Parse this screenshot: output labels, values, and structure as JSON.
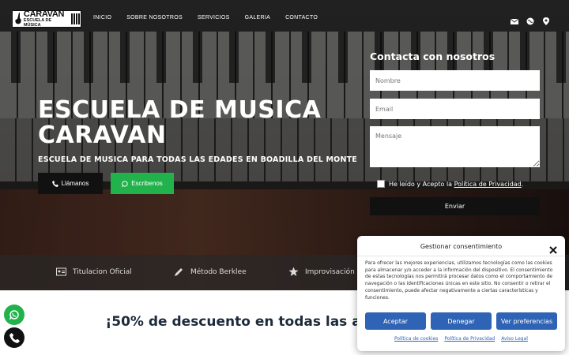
{
  "brand": {
    "logo_line1": "CARAVAN",
    "logo_line2": "ESCUELA DE MÚSICA"
  },
  "nav": {
    "items": [
      {
        "label": "INICIO"
      },
      {
        "label": "SOBRE NOSOTROS"
      },
      {
        "label": "SERVICIOS"
      },
      {
        "label": "GALERIA"
      },
      {
        "label": "CONTACTO"
      }
    ],
    "icons": [
      "envelope-icon",
      "globe-icon",
      "map-pin-icon"
    ]
  },
  "hero": {
    "title": "ESCUELA DE MUSICA CARAVAN",
    "subtitle": "ESCUELA DE MUSICA PARA TODAS LAS EDADES EN BOADILLA DEL MONTE",
    "call_label": "Llámanos",
    "write_label": "Escribenos"
  },
  "contact_form": {
    "title": "Contacta con nosotros",
    "name_placeholder": "Nombre",
    "email_placeholder": "Email",
    "message_placeholder": "Mensaje",
    "consent_prefix": "He leído y Acepto la ",
    "consent_link": "Política de Privacidad",
    "consent_suffix": ".",
    "submit_label": "Enviar"
  },
  "features": [
    {
      "label": "Titulacion Oficial",
      "icon": "id-card-icon"
    },
    {
      "label": "Método Berklee",
      "icon": "pencil-icon"
    },
    {
      "label": "Improvisación",
      "icon": "star-icon"
    }
  ],
  "promo": {
    "text": "¡50% de descuento en todas las actividad                   mes!"
  },
  "consent_modal": {
    "title": "Gestionar consentimiento",
    "body": "Para ofrecer las mejores experiencias, utilizamos tecnologías como las cookies para almacenar y/o acceder a la información del dispositivo. El consentimiento de estas tecnologías nos permitirá procesar datos como el comportamiento de navegación o las identificaciones únicas en este sitio. No consentir o retirar el consentimiento, puede afectar negativamente a ciertas características y funciones.",
    "accept_label": "Aceptar",
    "deny_label": "Denegar",
    "prefs_label": "Ver preferencias",
    "links": [
      "Política de cookies",
      "Política de Privacidad",
      "Aviso Legal"
    ]
  },
  "colors": {
    "green": "#21b24b",
    "modal_blue": "#2f63b5",
    "promo_text": "#1d2a3a"
  }
}
